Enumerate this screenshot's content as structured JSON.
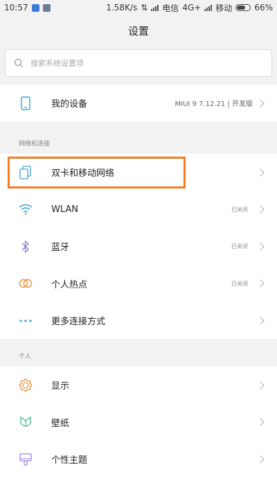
{
  "status": {
    "time": "10:57",
    "speed": "1.58K/s",
    "carrier1": "电信",
    "network": "4G+",
    "carrier2": "移动",
    "battery": "66%"
  },
  "header": {
    "title": "设置"
  },
  "search": {
    "placeholder": "搜索系统设置项"
  },
  "device_row": {
    "label": "我的设备",
    "value": "MIUI 9 7.12.21 | 开发版"
  },
  "sections": {
    "network_title": "网络和连接",
    "personal_title": "个人"
  },
  "network_items": [
    {
      "label": "双卡和移动网络",
      "value": "",
      "icon": "dual-sim-icon"
    },
    {
      "label": "WLAN",
      "value": "已关闭",
      "icon": "wifi-icon"
    },
    {
      "label": "蓝牙",
      "value": "已关闭",
      "icon": "bluetooth-icon"
    },
    {
      "label": "个人热点",
      "value": "已关闭",
      "icon": "hotspot-icon"
    },
    {
      "label": "更多连接方式",
      "value": "",
      "icon": "more-dots-icon"
    }
  ],
  "personal_items": [
    {
      "label": "显示",
      "icon": "display-icon"
    },
    {
      "label": "壁纸",
      "icon": "wallpaper-icon"
    },
    {
      "label": "个性主题",
      "icon": "theme-icon"
    }
  ],
  "colors": {
    "accent": "#f57c1f",
    "icon_blue": "#3aa0d6"
  }
}
